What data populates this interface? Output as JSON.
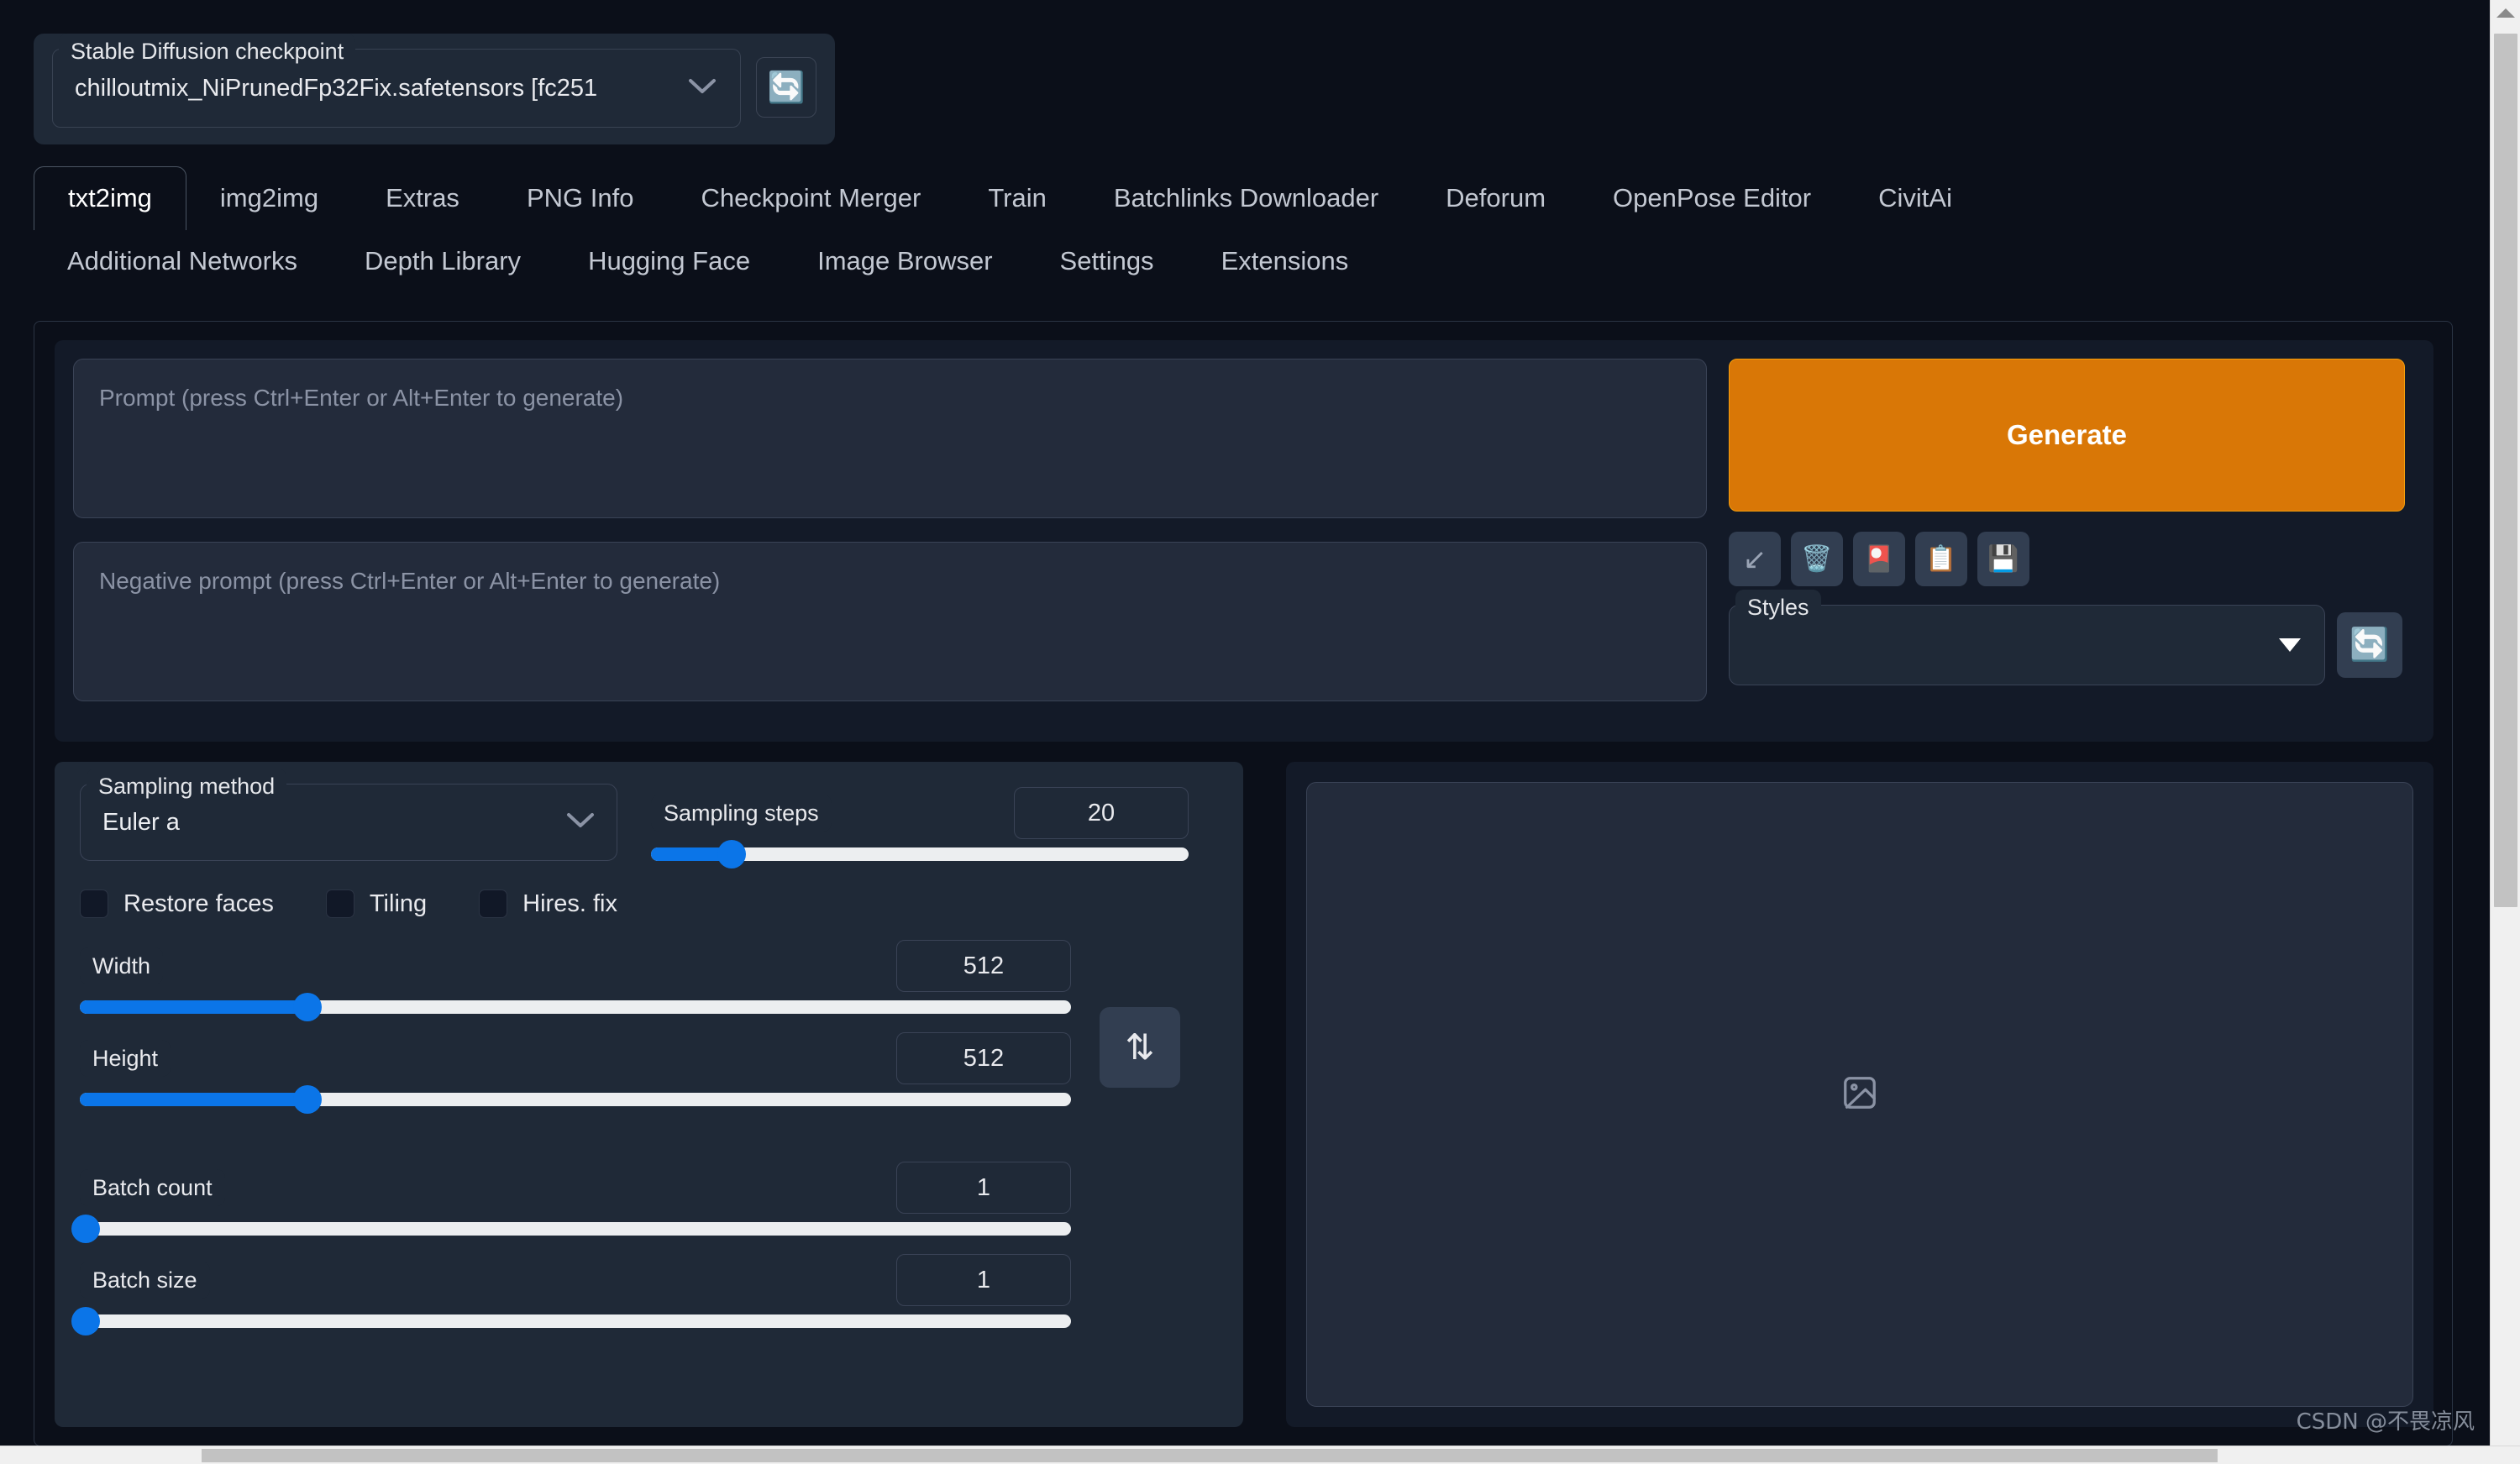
{
  "colors": {
    "page_background": "#0b0f19",
    "panel_background": "#1f2937",
    "panel_inner": "#131a28",
    "field_background": "#232b3b",
    "border": "#3a4356",
    "generate_orange": "#d97706",
    "generate_orange_border": "#f59e0b",
    "slider_blue": "#0b75e8",
    "slider_track": "#eceef0",
    "text_primary": "#e9eaee",
    "text_muted": "#8b93a5",
    "scrollbar_track": "#f0f0f0",
    "scrollbar_thumb": "#c2c2c2"
  },
  "checkpoint": {
    "label": "Stable Diffusion checkpoint",
    "value": "chilloutmix_NiPrunedFp32Fix.safetensors [fc251",
    "refresh_icon": "🔄",
    "chevron_icon": "chevron-down-icon"
  },
  "tabs": {
    "row1": [
      {
        "label": "txt2img",
        "active": true
      },
      {
        "label": "img2img",
        "active": false
      },
      {
        "label": "Extras",
        "active": false
      },
      {
        "label": "PNG Info",
        "active": false
      },
      {
        "label": "Checkpoint Merger",
        "active": false
      },
      {
        "label": "Train",
        "active": false
      },
      {
        "label": "Batchlinks Downloader",
        "active": false
      },
      {
        "label": "Deforum",
        "active": false
      },
      {
        "label": "OpenPose Editor",
        "active": false
      },
      {
        "label": "CivitAi",
        "active": false
      }
    ],
    "row2": [
      {
        "label": "Additional Networks",
        "active": false
      },
      {
        "label": "Depth Library",
        "active": false
      },
      {
        "label": "Hugging Face",
        "active": false
      },
      {
        "label": "Image Browser",
        "active": false
      },
      {
        "label": "Settings",
        "active": false
      },
      {
        "label": "Extensions",
        "active": false
      }
    ]
  },
  "prompt": {
    "positive_value": "",
    "positive_placeholder": "Prompt (press Ctrl+Enter or Alt+Enter to generate)",
    "negative_value": "",
    "negative_placeholder": "Negative prompt (press Ctrl+Enter or Alt+Enter to generate)"
  },
  "actions": {
    "generate_label": "Generate",
    "tools": [
      {
        "name": "read-generation-parameters-button",
        "icon": "↙"
      },
      {
        "name": "clear-prompt-button",
        "icon": "🗑️"
      },
      {
        "name": "show-extra-networks-button",
        "icon": "🎴"
      },
      {
        "name": "apply-style-button",
        "icon": "📋"
      },
      {
        "name": "save-style-button",
        "icon": "💾"
      }
    ]
  },
  "styles": {
    "label": "Styles",
    "value": "",
    "refresh_icon": "🔄",
    "caret_icon": "caret-down-icon"
  },
  "settings": {
    "sampling_method": {
      "label": "Sampling method",
      "value": "Euler a",
      "chevron_icon": "chevron-down-icon"
    },
    "sampling_steps": {
      "label": "Sampling steps",
      "value": "20",
      "min": 1,
      "max": 150,
      "percent": 15
    },
    "checkboxes": [
      {
        "label": "Restore faces",
        "checked": false
      },
      {
        "label": "Tiling",
        "checked": false
      },
      {
        "label": "Hires. fix",
        "checked": false
      }
    ],
    "width": {
      "label": "Width",
      "value": "512",
      "min": 64,
      "max": 2048,
      "percent": 23
    },
    "height": {
      "label": "Height",
      "value": "512",
      "min": 64,
      "max": 2048,
      "percent": 23
    },
    "swap_button": {
      "name": "swap-width-height-button",
      "icon": "⇅"
    },
    "batch_count": {
      "label": "Batch count",
      "value": "1",
      "min": 1,
      "max": 100,
      "percent": 0
    },
    "batch_size": {
      "label": "Batch size",
      "value": "1",
      "min": 1,
      "max": 8,
      "percent": 0
    }
  },
  "output": {
    "placeholder_icon": "image-placeholder-icon"
  },
  "watermark": {
    "text": "CSDN @不畏凉风"
  }
}
